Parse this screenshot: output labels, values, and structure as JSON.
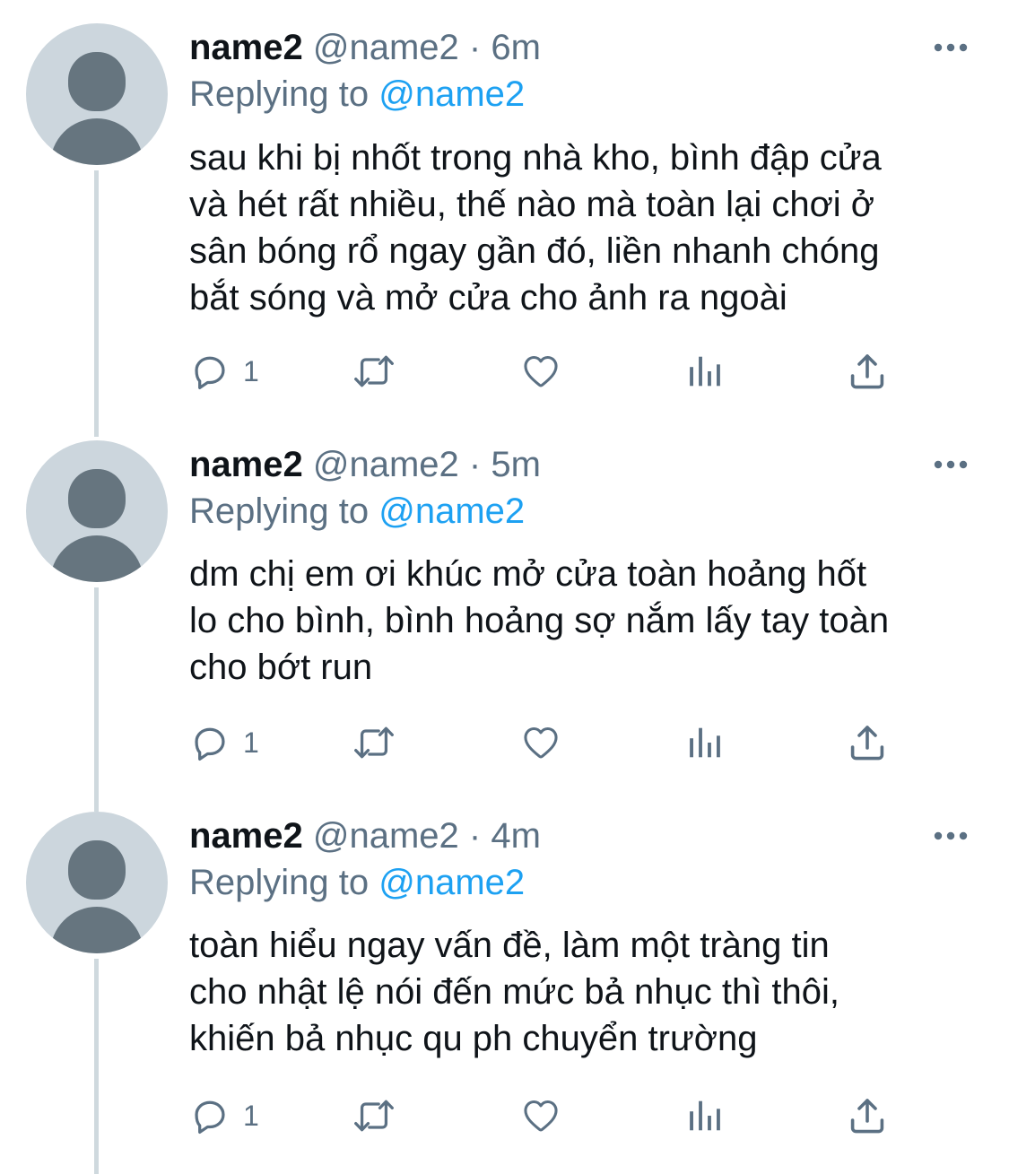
{
  "tweets": [
    {
      "name": "name2",
      "handle": "@name2",
      "separator": "·",
      "time": "6m",
      "replying_prefix": "Replying to",
      "replying_to": "@name2",
      "text": "sau khi bị nhốt trong nhà kho, bình đập cửa\nvà hét rất nhiều, thế nào mà toàn lại chơi ở\nsân bóng rổ ngay gần đó, liền nhanh chóng\nbắt sóng và mở cửa cho ảnh ra ngoài",
      "reply_count": "1"
    },
    {
      "name": "name2",
      "handle": "@name2",
      "separator": "·",
      "time": "5m",
      "replying_prefix": "Replying to",
      "replying_to": "@name2",
      "text": "dm chị em ơi khúc mở cửa toàn hoảng hốt\nlo cho bình, bình hoảng sợ nắm lấy tay toàn\ncho bớt run",
      "reply_count": "1"
    },
    {
      "name": "name2",
      "handle": "@name2",
      "separator": "·",
      "time": "4m",
      "replying_prefix": "Replying to",
      "replying_to": "@name2",
      "text": "toàn hiểu ngay vấn đề, làm một tràng tin\ncho nhật lệ nói đến mức bả nhục thì thôi,\nkhiến bả nhục qu ph chuyển trường",
      "reply_count": "1"
    }
  ],
  "icons": {
    "avatar": "default-profile-avatar",
    "more": "more-dots-icon",
    "reply": "reply-bubble-icon",
    "retweet": "retweet-icon",
    "like": "heart-icon",
    "stats": "analytics-bars-icon",
    "share": "share-upload-icon"
  },
  "colors": {
    "text_primary": "#0f1419",
    "text_secondary": "#5b7083",
    "link": "#1da1f2",
    "avatar_bg": "#ccd6dd",
    "avatar_fg": "#66757f",
    "thread_line": "#cfd9de"
  }
}
